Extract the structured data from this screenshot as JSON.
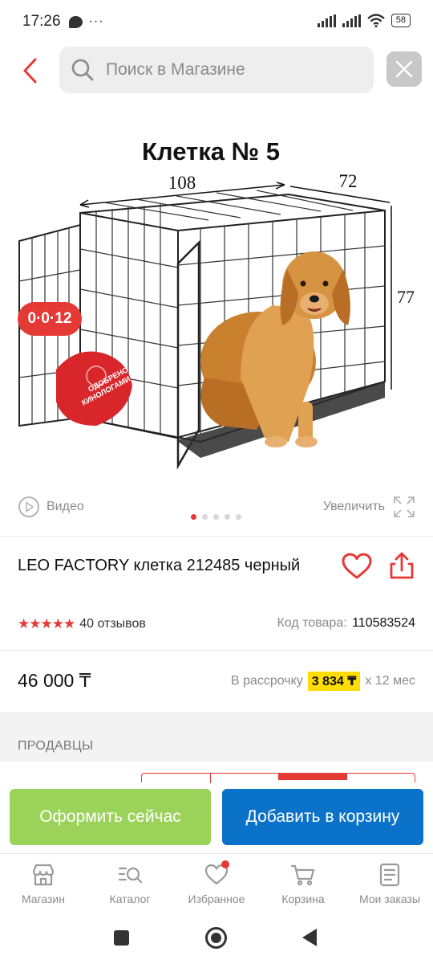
{
  "status_bar": {
    "time": "17:26",
    "dots": "···",
    "battery": "58"
  },
  "search": {
    "placeholder": "Поиск в Магазине"
  },
  "product_image": {
    "heading": "Клетка № 5",
    "dim_length": "108",
    "dim_width": "72",
    "dim_height": "77",
    "stamp_line1": "ОДОБРЕНО",
    "stamp_line2": "КИНОЛОГАМИ"
  },
  "promo_badge": "0·0·12",
  "media": {
    "video_label": "Видео",
    "zoom_label": "Увеличить",
    "image_count": 5,
    "active_index": 0
  },
  "product": {
    "title": "LEO FACTORY клетка 212485 черный",
    "rating_stars": "★★★★★",
    "reviews": "40 отзывов",
    "sku_label": "Код товара:",
    "sku_value": "110583524",
    "price": "46 000 ₸",
    "installment_label": "В рассрочку",
    "installment_amount": "3 834 ₸",
    "installment_term": "x 12 мес"
  },
  "sellers_label": "ПРОДАВЦЫ",
  "actions": {
    "buy_now": "Оформить сейчас",
    "add_to_cart": "Добавить в корзину"
  },
  "bottom_nav": [
    {
      "label": "Магазин",
      "icon": "store-icon"
    },
    {
      "label": "Каталог",
      "icon": "catalog-search-icon"
    },
    {
      "label": "Избранное",
      "icon": "heart-icon",
      "badge": true
    },
    {
      "label": "Корзина",
      "icon": "cart-icon"
    },
    {
      "label": "Мои заказы",
      "icon": "orders-icon"
    }
  ],
  "colors": {
    "accent_red": "#e53935",
    "buy_now_green": "#9bd35a",
    "cart_blue": "#0a72c8",
    "installment_yellow": "#ffdd00"
  }
}
